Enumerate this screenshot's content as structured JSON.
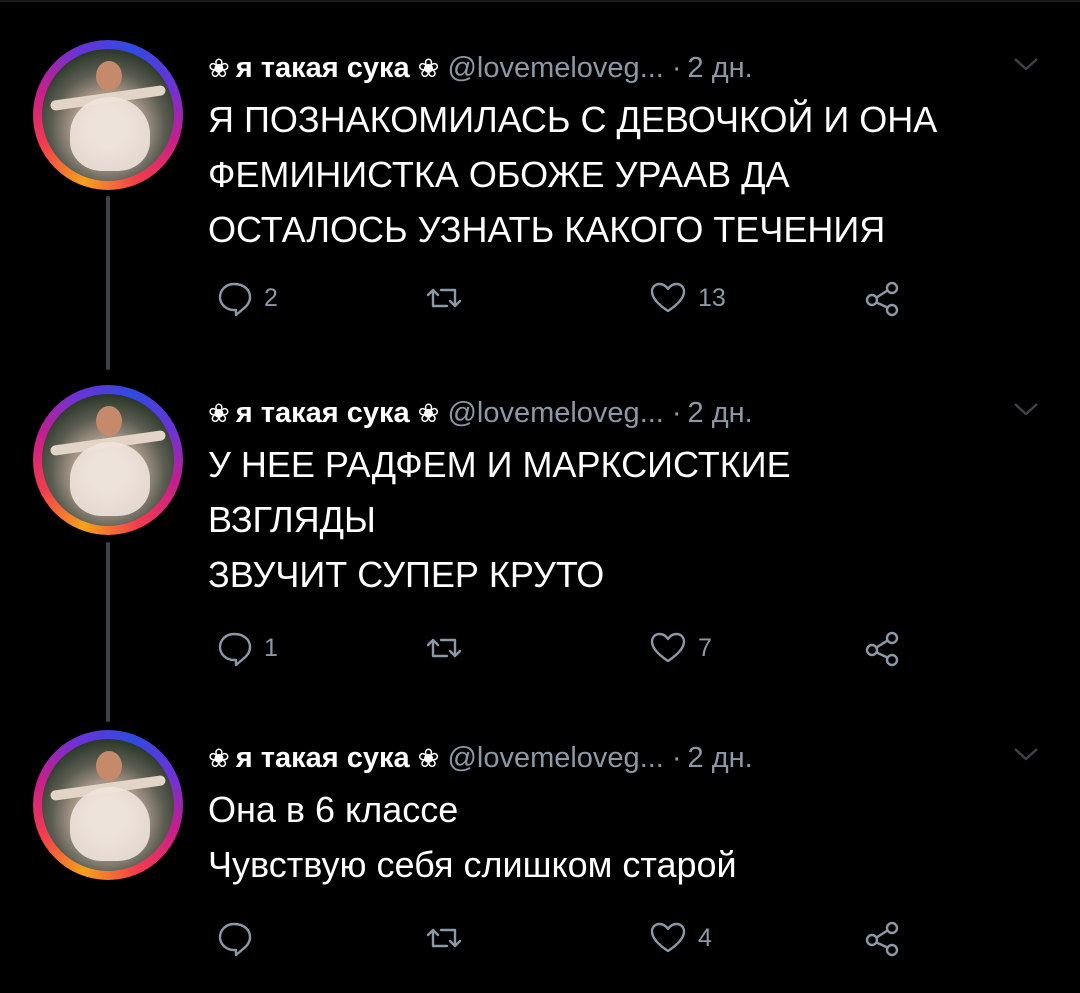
{
  "colors": {
    "background": "#000000",
    "text_primary": "#ffffff",
    "text_secondary": "#8b98a5",
    "thread_line": "#3d4248"
  },
  "tweets": [
    {
      "flower": "❀",
      "display_name": "я такая сука",
      "handle": "@lovemeloveg...",
      "separator": "·",
      "time": "2 дн.",
      "lines": [
        "Я ПОЗНАКОМИЛАСЬ С ДЕВОЧКОЙ И ОНА",
        "ФЕМИНИСТКА ОБОЖЕ  УРААВ ДА",
        "ОСТАЛОСЬ УЗНАТЬ КАКОГО ТЕЧЕНИЯ"
      ],
      "reply_count": "2",
      "retweet_count": "",
      "like_count": "13",
      "icons": [
        "reply-icon",
        "retweet-icon",
        "like-icon",
        "share-icon"
      ]
    },
    {
      "flower": "❀",
      "display_name": "я такая сука",
      "handle": "@lovemeloveg...",
      "separator": "·",
      "time": "2 дн.",
      "lines": [
        "У НЕЕ РАДФЕМ И МАРКСИСТКИЕ",
        "ВЗГЛЯДЫ",
        "ЗВУЧИТ СУПЕР КРУТО"
      ],
      "reply_count": "1",
      "retweet_count": "",
      "like_count": "7",
      "icons": [
        "reply-icon",
        "retweet-icon",
        "like-icon",
        "share-icon"
      ]
    },
    {
      "flower": "❀",
      "display_name": "я такая сука",
      "handle": "@lovemeloveg...",
      "separator": "·",
      "time": "2 дн.",
      "lines": [
        "Она в 6 классе",
        "Чувствую себя слишком старой"
      ],
      "reply_count": "",
      "retweet_count": "",
      "like_count": "4",
      "icons": [
        "reply-icon",
        "retweet-icon",
        "like-icon",
        "share-icon"
      ]
    }
  ]
}
